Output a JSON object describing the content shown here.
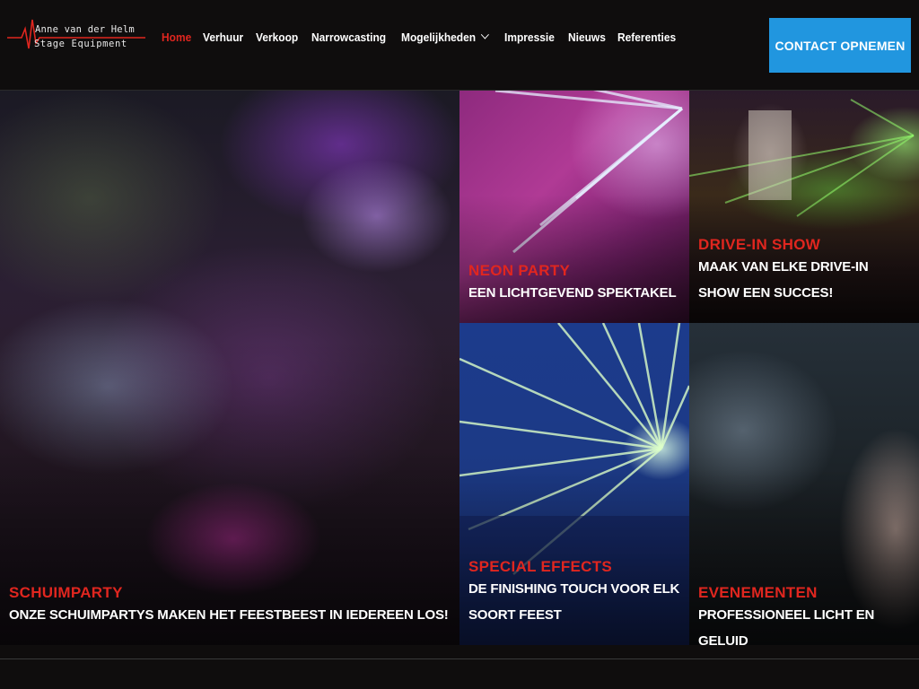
{
  "brand": {
    "line1": "Anne van der Helm",
    "line2": "Stage Equipment",
    "accent": "#e0261f"
  },
  "nav": {
    "items": [
      {
        "label": "Home",
        "active": true
      },
      {
        "label": "Verhuur"
      },
      {
        "label": "Verkoop"
      },
      {
        "label": "Narrowcasting"
      },
      {
        "label": "Mogelijkheden",
        "dropdown": true
      },
      {
        "label": "Impressie"
      },
      {
        "label": "Nieuws"
      },
      {
        "label": "Referenties"
      }
    ],
    "chevron_icon": "chevron-down-icon"
  },
  "cta": {
    "label": "CONTACT OPNEMEN",
    "color": "#2196df"
  },
  "tiles": [
    {
      "category": "SCHUIMPARTY",
      "subtitle": "ONZE SCHUIMPARTYS MAKEN HET FEESTBEEST IN IEDEREEN LOS!"
    },
    {
      "category": "NEON PARTY",
      "subtitle": "EEN LICHTGEVEND SPEKTAKEL"
    },
    {
      "category": "DRIVE-IN SHOW",
      "subtitle": "MAAK VAN ELKE DRIVE-IN SHOW EEN SUCCES!"
    },
    {
      "category": "SPECIAL EFFECTS",
      "subtitle": "DE FINISHING TOUCH VOOR ELK SOORT FEEST"
    },
    {
      "category": "EVENEMENTEN",
      "subtitle": "PROFESSIONEEL LICHT EN GELUID"
    }
  ]
}
